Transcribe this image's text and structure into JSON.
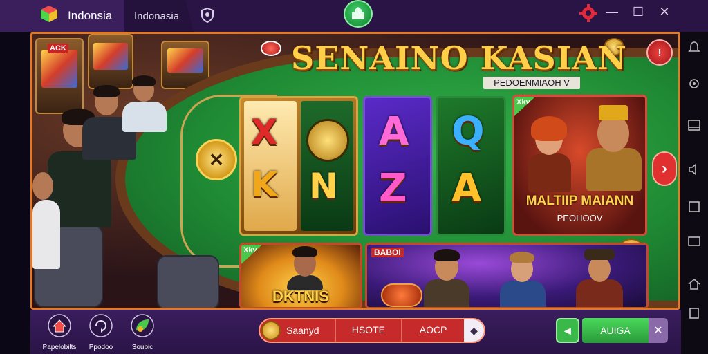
{
  "window": {
    "app_title": "Indonsia",
    "tab_2_label": "Indonasia",
    "minimize_glyph": "—",
    "maximize_glyph": "☐",
    "close_glyph": "✕"
  },
  "game": {
    "title": "SENAINO KASIAN",
    "subtitle": "PEDOENMIAOH V",
    "machine_label": "ACK",
    "alert_glyph": "!",
    "next_glyph": "›",
    "coin_glyph": "✕",
    "cards": [
      {
        "letters": [
          "X",
          "K",
          "N"
        ]
      },
      {
        "letters": [
          "A",
          "Z"
        ]
      },
      {
        "letters": [
          "Q",
          "A"
        ]
      },
      {
        "label": "MALTIIP MAIANN",
        "sub": "PEOHOOV",
        "badge": "Xky"
      },
      {
        "label": "DKTNIS",
        "badge": "Xky"
      },
      {
        "tag": "BABOI"
      }
    ]
  },
  "bottom_nav": {
    "items": [
      {
        "label": "Papelobilts",
        "icon": "home-icon"
      },
      {
        "label": "Ppodoo",
        "icon": "refresh-icon"
      },
      {
        "label": "Soubic",
        "icon": "leaf-icon"
      }
    ],
    "search_label": "Saanyd",
    "segment_1": "HSOTE",
    "segment_2": "AOCP",
    "segment_arrow": "◆",
    "back_glyph": "◂",
    "action_label": "AUIGA",
    "dismiss_glyph": "✕"
  },
  "colors": {
    "frame_border": "#e07a2a",
    "title_gold": "#ffcf4a",
    "felt_green": "#1f8a34",
    "alert_red": "#e03030",
    "action_green": "#3ab84a"
  }
}
